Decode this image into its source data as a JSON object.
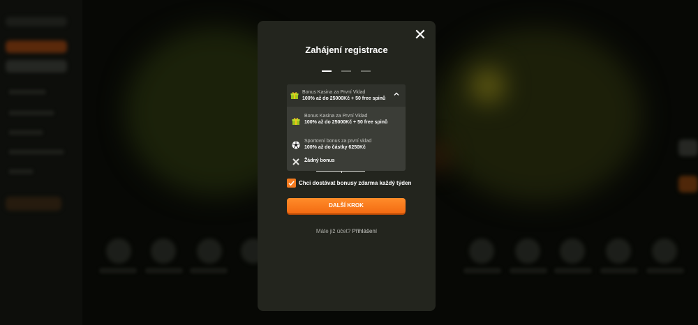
{
  "modal": {
    "title": "Zahájení registrace",
    "close_symbol": "✕",
    "steps_total": 3,
    "steps_active": 1
  },
  "bonus_select": {
    "selected_title": "Bonus Kasina za První Vklad",
    "selected_detail": "100% až do 25000Kč + 50 free spinů",
    "options": [
      {
        "title": "Bonus Kasina za První Vklad",
        "detail": "100% až do 25000Kč + 50 free spinů",
        "icon": "gift-icon"
      },
      {
        "title": "Sportovní bonus za první vklad",
        "detail": "100% až do částky 6250Kč",
        "icon": "soccer-ball-icon"
      },
      {
        "title": "Žádný bonus",
        "detail": "",
        "icon": "cross-icon"
      }
    ]
  },
  "weekly_bonus": {
    "checked": true,
    "label": "Chci dostávat bonusy zdarma každý týden"
  },
  "next_button": {
    "label": "DALŠÍ KROK"
  },
  "login": {
    "question": "Máte již účet?",
    "link": "Přihlášení"
  },
  "colors": {
    "accent": "#f47a1f",
    "modal_bg": "#23251e",
    "dropdown_bg": "#3b3d37"
  }
}
